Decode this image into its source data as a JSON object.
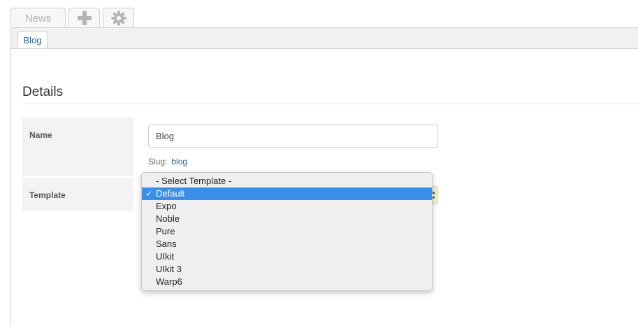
{
  "top_tabs": [
    {
      "label": "News",
      "icon": "none"
    },
    {
      "label": "",
      "icon": "plus-icon"
    },
    {
      "label": "",
      "icon": "gear-icon"
    }
  ],
  "subtabs": [
    {
      "label": "Blog"
    }
  ],
  "section": {
    "title": "Details"
  },
  "fields": {
    "name_label": "Name",
    "name_value": "Blog",
    "slug_label": "Slug:",
    "slug_value": "blog",
    "template_label": "Template"
  },
  "template_dropdown": {
    "selected": "Default",
    "check_mark": "✓",
    "options": [
      {
        "label": "- Select Template -"
      },
      {
        "label": "Default"
      },
      {
        "label": "Expo"
      },
      {
        "label": "Noble"
      },
      {
        "label": "Pure"
      },
      {
        "label": "Sans"
      },
      {
        "label": "UIkit"
      },
      {
        "label": "UIkit 3"
      },
      {
        "label": "Warp6"
      }
    ]
  },
  "colors": {
    "link": "#2a6496",
    "selection": "#3b8ee8",
    "select_arrow_bg": "#f5f2c8"
  }
}
